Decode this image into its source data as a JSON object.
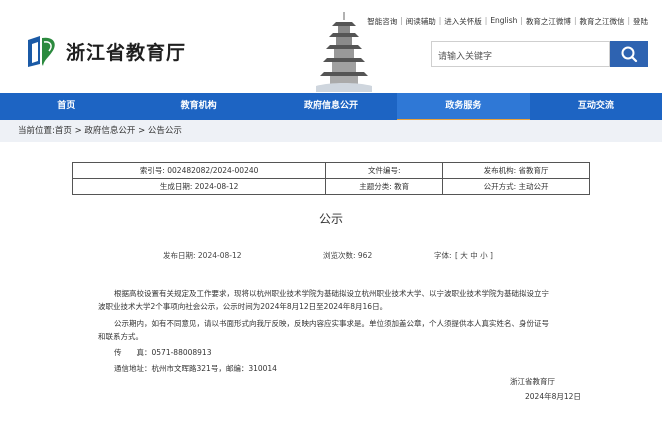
{
  "site": {
    "name": "浙江省教育厅"
  },
  "toplinks": [
    "智能咨询",
    "阅读辅助",
    "进入关怀版",
    "English",
    "教育之江微博",
    "教育之江微信",
    "登陆"
  ],
  "search": {
    "placeholder": "请输入关键字"
  },
  "nav": [
    {
      "label": "首页"
    },
    {
      "label": "教育机构"
    },
    {
      "label": "政府信息公开"
    },
    {
      "label": "政务服务",
      "active": true
    },
    {
      "label": "互动交流"
    }
  ],
  "breadcrumb": "当前位置:首页 > 政府信息公开 > 公告公示",
  "meta": {
    "index_no": "索引号: 002482082/2024-00240",
    "doc_no": "文件编号:",
    "publisher": "发布机构: 省教育厅",
    "created": "生成日期: 2024-08-12",
    "topic": "主题分类: 教育",
    "open_mode": "公开方式: 主动公开"
  },
  "article": {
    "title": "公示",
    "publish_date": "发布日期: 2024-08-12",
    "views": "浏览次数: 962",
    "font_label": "字体:",
    "font_size": "[ 大 中 小 ]",
    "para1_line1": "根据高校设置有关规定及工作要求，现将以杭州职业技术学院为基础拟设立杭州职业技术大学、以宁波职业技术学院为基础拟设立宁",
    "para1_line2": "波职业技术大学2个事项向社会公示，公示时间为2024年8月12日至2024年8月16日。",
    "para2_line1": "公示期内，如有不同意见，请以书面形式向我厅反映，反映内容应实事求是。单位须加盖公章，个人须提供本人真实姓名、身份证号",
    "para2_line2": "和联系方式。",
    "fax": "传　　真：0571-88008913",
    "address": "通信地址：杭州市文晖路321号，邮编：310014",
    "signer": "浙江省教育厅",
    "sign_date": "2024年8月12日"
  }
}
